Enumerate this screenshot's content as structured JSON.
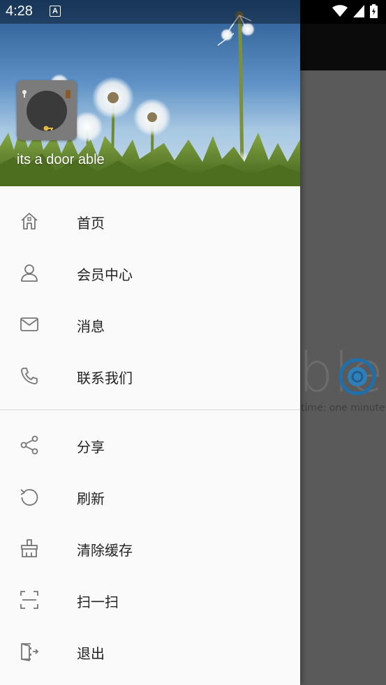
{
  "status_bar": {
    "time": "4:28",
    "notification_letter": "A"
  },
  "background_app": {
    "logo_text": "ble",
    "subtitle": "time: one minute"
  },
  "drawer": {
    "header": {
      "username": "its a door able"
    },
    "menu_group_1": [
      {
        "label": "首页",
        "icon": "home-icon"
      },
      {
        "label": "会员中心",
        "icon": "person-icon"
      },
      {
        "label": "消息",
        "icon": "mail-icon"
      },
      {
        "label": "联系我们",
        "icon": "phone-icon"
      }
    ],
    "menu_group_2": [
      {
        "label": "分享",
        "icon": "share-icon"
      },
      {
        "label": "刷新",
        "icon": "refresh-icon"
      },
      {
        "label": "清除缓存",
        "icon": "clean-brush-icon"
      },
      {
        "label": "扫一扫",
        "icon": "scan-icon"
      },
      {
        "label": "退出",
        "icon": "exit-icon"
      }
    ]
  },
  "colors": {
    "drawer_bg": "#fafafa",
    "menu_text": "#212121",
    "icon_stroke": "#757575",
    "scrim": "#5a5a5a"
  }
}
